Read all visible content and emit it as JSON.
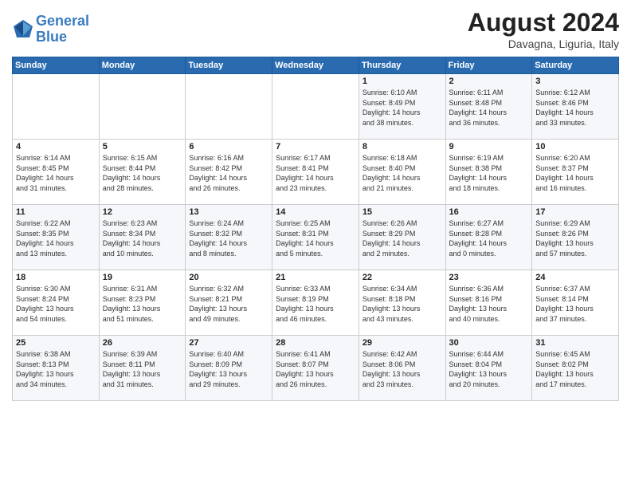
{
  "header": {
    "logo_line1": "General",
    "logo_line2": "Blue",
    "month_year": "August 2024",
    "location": "Davagna, Liguria, Italy"
  },
  "weekdays": [
    "Sunday",
    "Monday",
    "Tuesday",
    "Wednesday",
    "Thursday",
    "Friday",
    "Saturday"
  ],
  "weeks": [
    [
      {
        "day": "",
        "info": ""
      },
      {
        "day": "",
        "info": ""
      },
      {
        "day": "",
        "info": ""
      },
      {
        "day": "",
        "info": ""
      },
      {
        "day": "1",
        "info": "Sunrise: 6:10 AM\nSunset: 8:49 PM\nDaylight: 14 hours\nand 38 minutes."
      },
      {
        "day": "2",
        "info": "Sunrise: 6:11 AM\nSunset: 8:48 PM\nDaylight: 14 hours\nand 36 minutes."
      },
      {
        "day": "3",
        "info": "Sunrise: 6:12 AM\nSunset: 8:46 PM\nDaylight: 14 hours\nand 33 minutes."
      }
    ],
    [
      {
        "day": "4",
        "info": "Sunrise: 6:14 AM\nSunset: 8:45 PM\nDaylight: 14 hours\nand 31 minutes."
      },
      {
        "day": "5",
        "info": "Sunrise: 6:15 AM\nSunset: 8:44 PM\nDaylight: 14 hours\nand 28 minutes."
      },
      {
        "day": "6",
        "info": "Sunrise: 6:16 AM\nSunset: 8:42 PM\nDaylight: 14 hours\nand 26 minutes."
      },
      {
        "day": "7",
        "info": "Sunrise: 6:17 AM\nSunset: 8:41 PM\nDaylight: 14 hours\nand 23 minutes."
      },
      {
        "day": "8",
        "info": "Sunrise: 6:18 AM\nSunset: 8:40 PM\nDaylight: 14 hours\nand 21 minutes."
      },
      {
        "day": "9",
        "info": "Sunrise: 6:19 AM\nSunset: 8:38 PM\nDaylight: 14 hours\nand 18 minutes."
      },
      {
        "day": "10",
        "info": "Sunrise: 6:20 AM\nSunset: 8:37 PM\nDaylight: 14 hours\nand 16 minutes."
      }
    ],
    [
      {
        "day": "11",
        "info": "Sunrise: 6:22 AM\nSunset: 8:35 PM\nDaylight: 14 hours\nand 13 minutes."
      },
      {
        "day": "12",
        "info": "Sunrise: 6:23 AM\nSunset: 8:34 PM\nDaylight: 14 hours\nand 10 minutes."
      },
      {
        "day": "13",
        "info": "Sunrise: 6:24 AM\nSunset: 8:32 PM\nDaylight: 14 hours\nand 8 minutes."
      },
      {
        "day": "14",
        "info": "Sunrise: 6:25 AM\nSunset: 8:31 PM\nDaylight: 14 hours\nand 5 minutes."
      },
      {
        "day": "15",
        "info": "Sunrise: 6:26 AM\nSunset: 8:29 PM\nDaylight: 14 hours\nand 2 minutes."
      },
      {
        "day": "16",
        "info": "Sunrise: 6:27 AM\nSunset: 8:28 PM\nDaylight: 14 hours\nand 0 minutes."
      },
      {
        "day": "17",
        "info": "Sunrise: 6:29 AM\nSunset: 8:26 PM\nDaylight: 13 hours\nand 57 minutes."
      }
    ],
    [
      {
        "day": "18",
        "info": "Sunrise: 6:30 AM\nSunset: 8:24 PM\nDaylight: 13 hours\nand 54 minutes."
      },
      {
        "day": "19",
        "info": "Sunrise: 6:31 AM\nSunset: 8:23 PM\nDaylight: 13 hours\nand 51 minutes."
      },
      {
        "day": "20",
        "info": "Sunrise: 6:32 AM\nSunset: 8:21 PM\nDaylight: 13 hours\nand 49 minutes."
      },
      {
        "day": "21",
        "info": "Sunrise: 6:33 AM\nSunset: 8:19 PM\nDaylight: 13 hours\nand 46 minutes."
      },
      {
        "day": "22",
        "info": "Sunrise: 6:34 AM\nSunset: 8:18 PM\nDaylight: 13 hours\nand 43 minutes."
      },
      {
        "day": "23",
        "info": "Sunrise: 6:36 AM\nSunset: 8:16 PM\nDaylight: 13 hours\nand 40 minutes."
      },
      {
        "day": "24",
        "info": "Sunrise: 6:37 AM\nSunset: 8:14 PM\nDaylight: 13 hours\nand 37 minutes."
      }
    ],
    [
      {
        "day": "25",
        "info": "Sunrise: 6:38 AM\nSunset: 8:13 PM\nDaylight: 13 hours\nand 34 minutes."
      },
      {
        "day": "26",
        "info": "Sunrise: 6:39 AM\nSunset: 8:11 PM\nDaylight: 13 hours\nand 31 minutes."
      },
      {
        "day": "27",
        "info": "Sunrise: 6:40 AM\nSunset: 8:09 PM\nDaylight: 13 hours\nand 29 minutes."
      },
      {
        "day": "28",
        "info": "Sunrise: 6:41 AM\nSunset: 8:07 PM\nDaylight: 13 hours\nand 26 minutes."
      },
      {
        "day": "29",
        "info": "Sunrise: 6:42 AM\nSunset: 8:06 PM\nDaylight: 13 hours\nand 23 minutes."
      },
      {
        "day": "30",
        "info": "Sunrise: 6:44 AM\nSunset: 8:04 PM\nDaylight: 13 hours\nand 20 minutes."
      },
      {
        "day": "31",
        "info": "Sunrise: 6:45 AM\nSunset: 8:02 PM\nDaylight: 13 hours\nand 17 minutes."
      }
    ]
  ]
}
